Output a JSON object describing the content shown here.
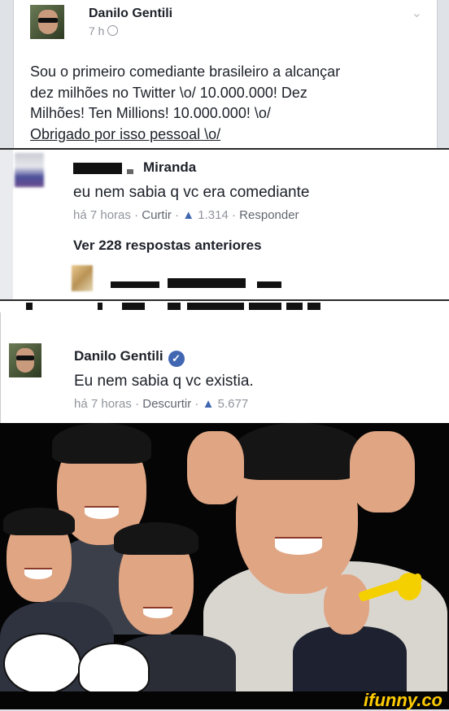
{
  "post": {
    "author": "Danilo Gentili",
    "time": "7 h",
    "text_line1": "Sou o primeiro comediante brasileiro a alcançar",
    "text_line2": "dez milhões no Twitter \\o/ 10.000.000! Dez",
    "text_line3": "Milhões! Ten Millions! 10.000.000! \\o/",
    "text_line4": "Obrigado por isso pessoal \\o/"
  },
  "comment": {
    "author_visible": "Miranda",
    "text": "eu nem sabia q vc era comediante",
    "time": "há 7 horas",
    "like_label": "Curtir",
    "likes": "1.314",
    "reply_label": "Responder",
    "more_replies": "Ver 228 respostas anteriores"
  },
  "reply": {
    "author": "Danilo Gentili",
    "verified_icon": "verified-check-icon",
    "text": "Eu nem sabia q vc existia.",
    "time": "há 7 horas",
    "unlike_label": "Descurtir",
    "likes": "5.677"
  },
  "watermark": "ifunny.co",
  "colors": {
    "link_gray": "#616770",
    "meta_gray": "#90949c",
    "verified_blue": "#4267b2",
    "watermark_yellow": "#ffcc00"
  }
}
